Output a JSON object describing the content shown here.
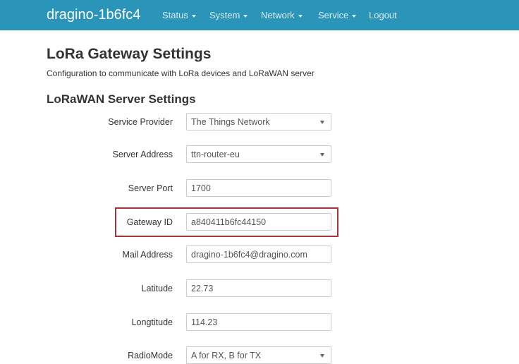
{
  "navbar": {
    "brand": "dragino-1b6fc4",
    "menu": [
      {
        "label": "Status",
        "dropdown": true
      },
      {
        "label": "System",
        "dropdown": true
      },
      {
        "label": "Network",
        "dropdown": true
      },
      {
        "label": "Service",
        "dropdown": true
      },
      {
        "label": "Logout",
        "dropdown": false
      }
    ]
  },
  "page": {
    "title": "LoRa Gateway Settings",
    "description": "Configuration to communicate with LoRa devices and LoRaWAN server"
  },
  "section": {
    "title": "LoRaWAN Server Settings"
  },
  "fields": {
    "service_provider": {
      "label": "Service Provider",
      "value": "The Things Network",
      "type": "select"
    },
    "server_address": {
      "label": "Server Address",
      "value": "ttn-router-eu",
      "type": "select"
    },
    "server_port": {
      "label": "Server Port",
      "value": "1700",
      "type": "text"
    },
    "gateway_id": {
      "label": "Gateway ID",
      "value": "a840411b6fc44150",
      "type": "text",
      "highlighted": true
    },
    "mail_address": {
      "label": "Mail Address",
      "value": "dragino-1b6fc4@dragino.com",
      "type": "text"
    },
    "latitude": {
      "label": "Latitude",
      "value": "22.73",
      "type": "text"
    },
    "longitude": {
      "label": "Longtitude",
      "value": "114.23",
      "type": "text"
    },
    "radio_mode": {
      "label": "RadioMode",
      "value": "A for RX, B for TX",
      "type": "select"
    }
  },
  "colors": {
    "navbar": "#2a94b9",
    "highlight_border": "#a3353a"
  }
}
